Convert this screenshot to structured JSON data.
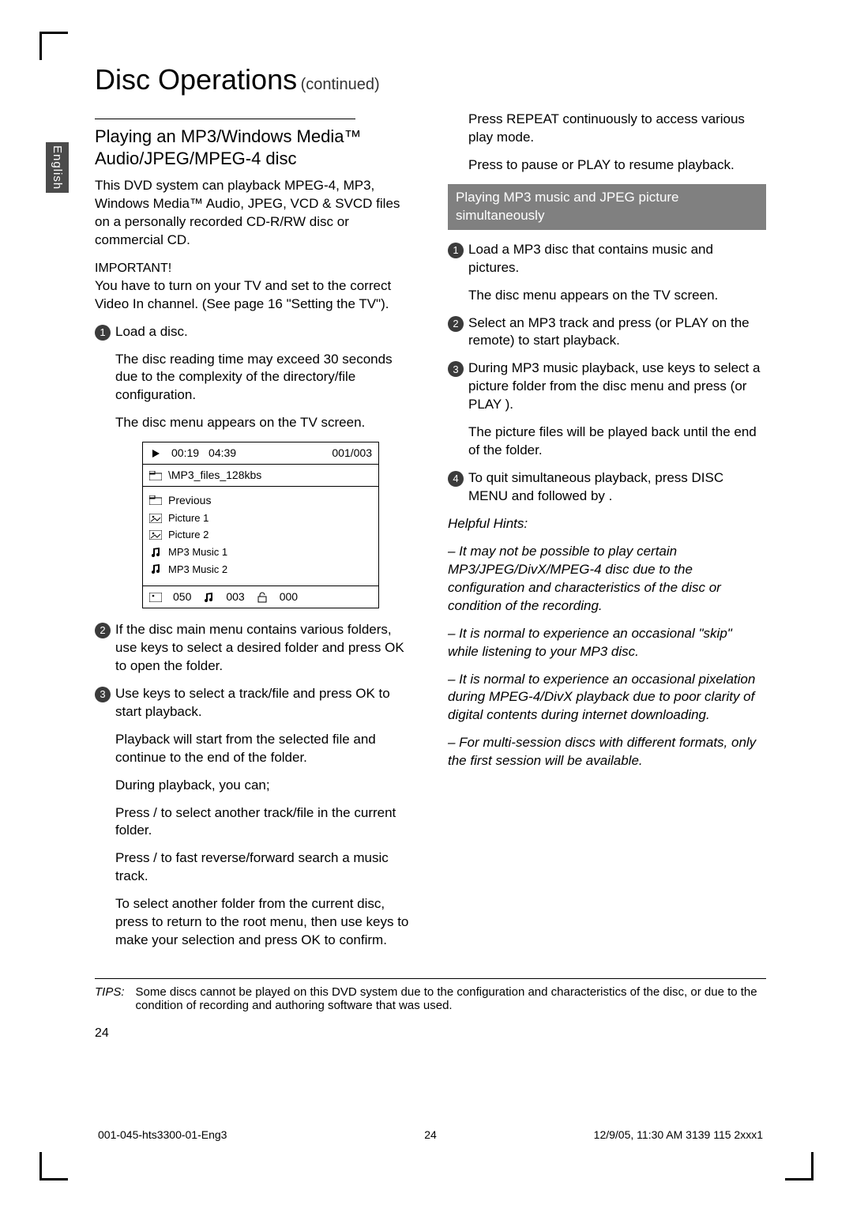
{
  "language_tab": "English",
  "header": {
    "title": "Disc Operations",
    "continued": "(continued)"
  },
  "left": {
    "section_heading": "Playing an MP3/Windows Media™ Audio/JPEG/MPEG-4 disc",
    "intro": "This DVD system can playback MPEG-4, MP3, Windows Media™ Audio, JPEG, VCD & SVCD files on a personally recorded CD-R/RW disc or commercial CD.",
    "important_label": "IMPORTANT!",
    "important_body": "You have to turn on your TV and set to the correct Video In channel.  (See page 16 \"Setting the TV\").",
    "step1": "Load a disc.",
    "step1_sub1": "The disc reading time may exceed 30 seconds due to the complexity of the directory/file configuration.",
    "step1_sub2": "The disc menu appears on the TV screen.",
    "step2": "If the disc main menu contains various folders, use        keys to select a desired folder and press OK to open the folder.",
    "step3": "Use        keys to select a track/file and press OK to start playback.",
    "step3_sub": "Playback will start from the selected file and continue to the end of the folder.",
    "during": "During playback, you can;",
    "p_prevnext": "Press        /        to select another track/file in the current folder.",
    "p_fast": "Press     /     to fast reverse/forward search a music track.",
    "p_folder": "To select another folder from the current disc, press     to return to the root menu, then use        keys to make your selection and press OK to confirm."
  },
  "menu": {
    "elapsed": "00:19",
    "total": "04:39",
    "index": "001/003",
    "path": "\\MP3_files_128kbs",
    "items": {
      "previous": "Previous",
      "pic1": "Picture 1",
      "pic2": "Picture 2",
      "mp3_1": "MP3 Music 1",
      "mp3_2": "MP3 Music 2"
    },
    "bottom_pic": "050",
    "bottom_music": "003",
    "bottom_lock": "000"
  },
  "right": {
    "p_repeat": "Press REPEAT continuously to access various play mode.",
    "p_pause": "Press      to pause or PLAY      to resume playback.",
    "subhead": "Playing MP3 music and JPEG picture simultaneously",
    "r1": "Load a MP3 disc that contains music and pictures.",
    "r1_sub": "The disc menu appears on the TV screen.",
    "r2": "Select an MP3 track and press      (or PLAY      on the remote) to start playback.",
    "r3": "During MP3 music playback, use        keys to select a picture folder from the disc menu and press      (or PLAY     ).",
    "r3_sub": "The picture files will be played back until the end of the folder.",
    "r4": "To quit simultaneous playback, press DISC MENU  and followed by      .",
    "hints_label": "Helpful Hints:",
    "hint1": "–  It may not be possible to play certain MP3/JPEG/DivX/MPEG-4 disc due to the configuration and characteristics of the disc or condition of the recording.",
    "hint2": "–  It is normal to experience an occasional \"skip\" while listening to your MP3 disc.",
    "hint3": "–  It is normal to experience an occasional pixelation during MPEG-4/DivX playback due to poor clarity of digital contents during internet downloading.",
    "hint4": "–  For multi-session discs with different formats, only the first session will be available."
  },
  "tips": {
    "label": "TIPS:",
    "body": "Some discs cannot be played on this DVD system due to the configuration and characteristics of the disc, or due to the condition of recording and authoring software that was used."
  },
  "page_number": "24",
  "footer": {
    "left": "001-045-hts3300-01-Eng3",
    "mid": "24",
    "right_date": "12/9/05, 11:30 AM",
    "right_code": "3139 115 2xxx1"
  }
}
